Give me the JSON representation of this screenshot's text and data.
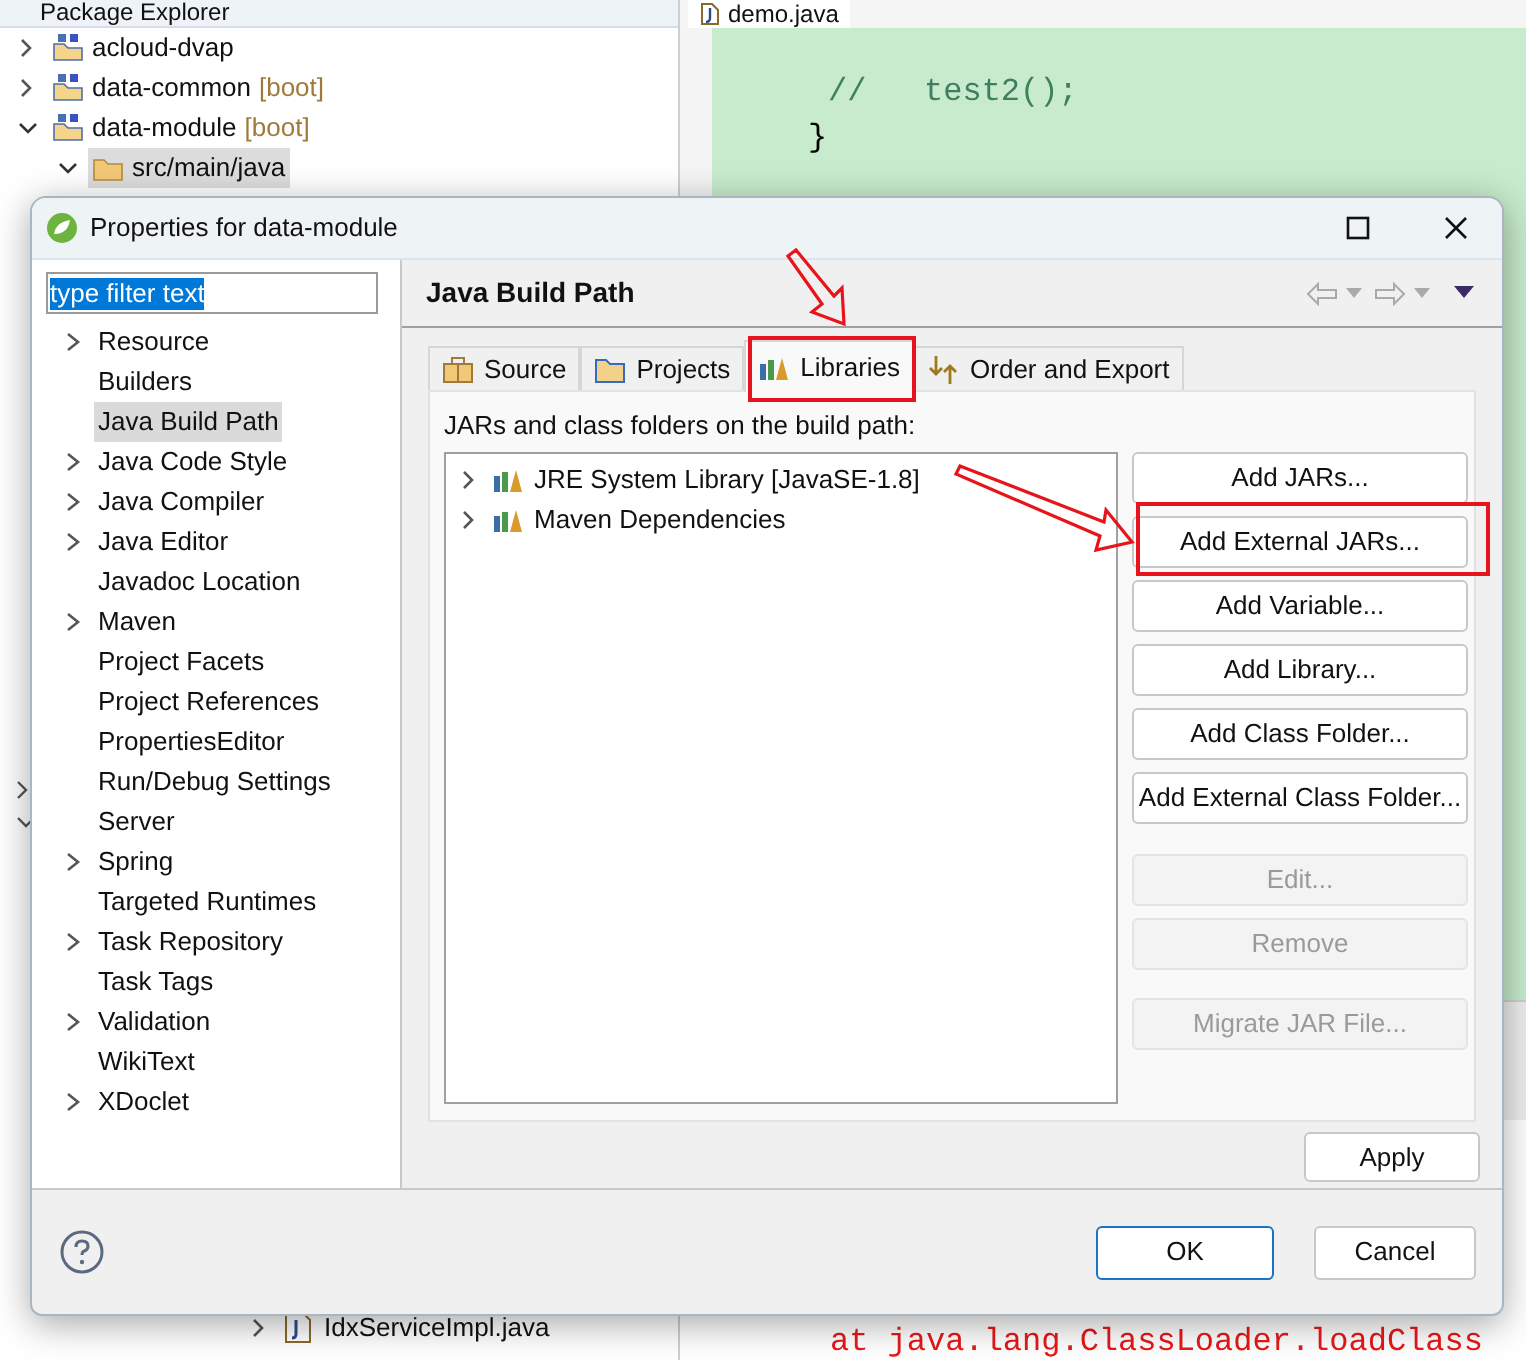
{
  "explorer": {
    "title": "Package Explorer",
    "items": [
      {
        "label": "acloud-dvap",
        "expanded": false,
        "selected": false
      },
      {
        "label": "data-common",
        "decoration": "[boot]",
        "expanded": false,
        "selected": false
      },
      {
        "label": "data-module",
        "decoration": "[boot]",
        "expanded": true,
        "selected": false,
        "children": [
          {
            "label": "src/main/java",
            "selected": true,
            "expanded": true
          }
        ]
      }
    ],
    "bottom_item": "IdxServiceImpl.java"
  },
  "editor": {
    "tab": "demo.java",
    "code": [
      "//   test2();",
      "}"
    ],
    "console_lines": [
      "at java.lang.ClassLoader.loadClass"
    ]
  },
  "dialog": {
    "title": "Properties for data-module",
    "filter": {
      "value": "type filter text",
      "text_selected": true
    },
    "nav": [
      {
        "label": "Resource",
        "expandable": true,
        "selected": false
      },
      {
        "label": "Builders",
        "expandable": false,
        "selected": false
      },
      {
        "label": "Java Build Path",
        "expandable": false,
        "selected": true
      },
      {
        "label": "Java Code Style",
        "expandable": true,
        "selected": false
      },
      {
        "label": "Java Compiler",
        "expandable": true,
        "selected": false
      },
      {
        "label": "Java Editor",
        "expandable": true,
        "selected": false
      },
      {
        "label": "Javadoc Location",
        "expandable": false,
        "selected": false
      },
      {
        "label": "Maven",
        "expandable": true,
        "selected": false
      },
      {
        "label": "Project Facets",
        "expandable": false,
        "selected": false
      },
      {
        "label": "Project References",
        "expandable": false,
        "selected": false
      },
      {
        "label": "PropertiesEditor",
        "expandable": false,
        "selected": false
      },
      {
        "label": "Run/Debug Settings",
        "expandable": false,
        "selected": false
      },
      {
        "label": "Server",
        "expandable": false,
        "selected": false
      },
      {
        "label": "Spring",
        "expandable": true,
        "selected": false
      },
      {
        "label": "Targeted Runtimes",
        "expandable": false,
        "selected": false
      },
      {
        "label": "Task Repository",
        "expandable": true,
        "selected": false
      },
      {
        "label": "Task Tags",
        "expandable": false,
        "selected": false
      },
      {
        "label": "Validation",
        "expandable": true,
        "selected": false
      },
      {
        "label": "WikiText",
        "expandable": false,
        "selected": false
      },
      {
        "label": "XDoclet",
        "expandable": true,
        "selected": false
      }
    ],
    "page_title": "Java Build Path",
    "tabs": [
      {
        "label": "Source",
        "kind": "source",
        "selected": false
      },
      {
        "label": "Projects",
        "kind": "projects",
        "selected": false
      },
      {
        "label": "Libraries",
        "kind": "libraries",
        "selected": true
      },
      {
        "label": "Order and Export",
        "kind": "order",
        "selected": false
      }
    ],
    "list_label": "JARs and class folders on the build path:",
    "libraries": [
      {
        "label": "JRE System Library [JavaSE-1.8]",
        "expanded": false
      },
      {
        "label": "Maven Dependencies",
        "expanded": false
      }
    ],
    "button_groups": [
      [
        {
          "label": "Add JARs...",
          "disabled": false
        },
        {
          "label": "Add External JARs...",
          "disabled": false
        },
        {
          "label": "Add Variable...",
          "disabled": false
        },
        {
          "label": "Add Library...",
          "disabled": false
        },
        {
          "label": "Add Class Folder...",
          "disabled": false
        },
        {
          "label": "Add External Class Folder...",
          "disabled": false
        }
      ],
      [
        {
          "label": "Edit...",
          "disabled": true
        },
        {
          "label": "Remove",
          "disabled": true
        }
      ],
      [
        {
          "label": "Migrate JAR File...",
          "disabled": true
        }
      ]
    ],
    "apply": "Apply",
    "ok": "OK",
    "cancel": "Cancel"
  }
}
